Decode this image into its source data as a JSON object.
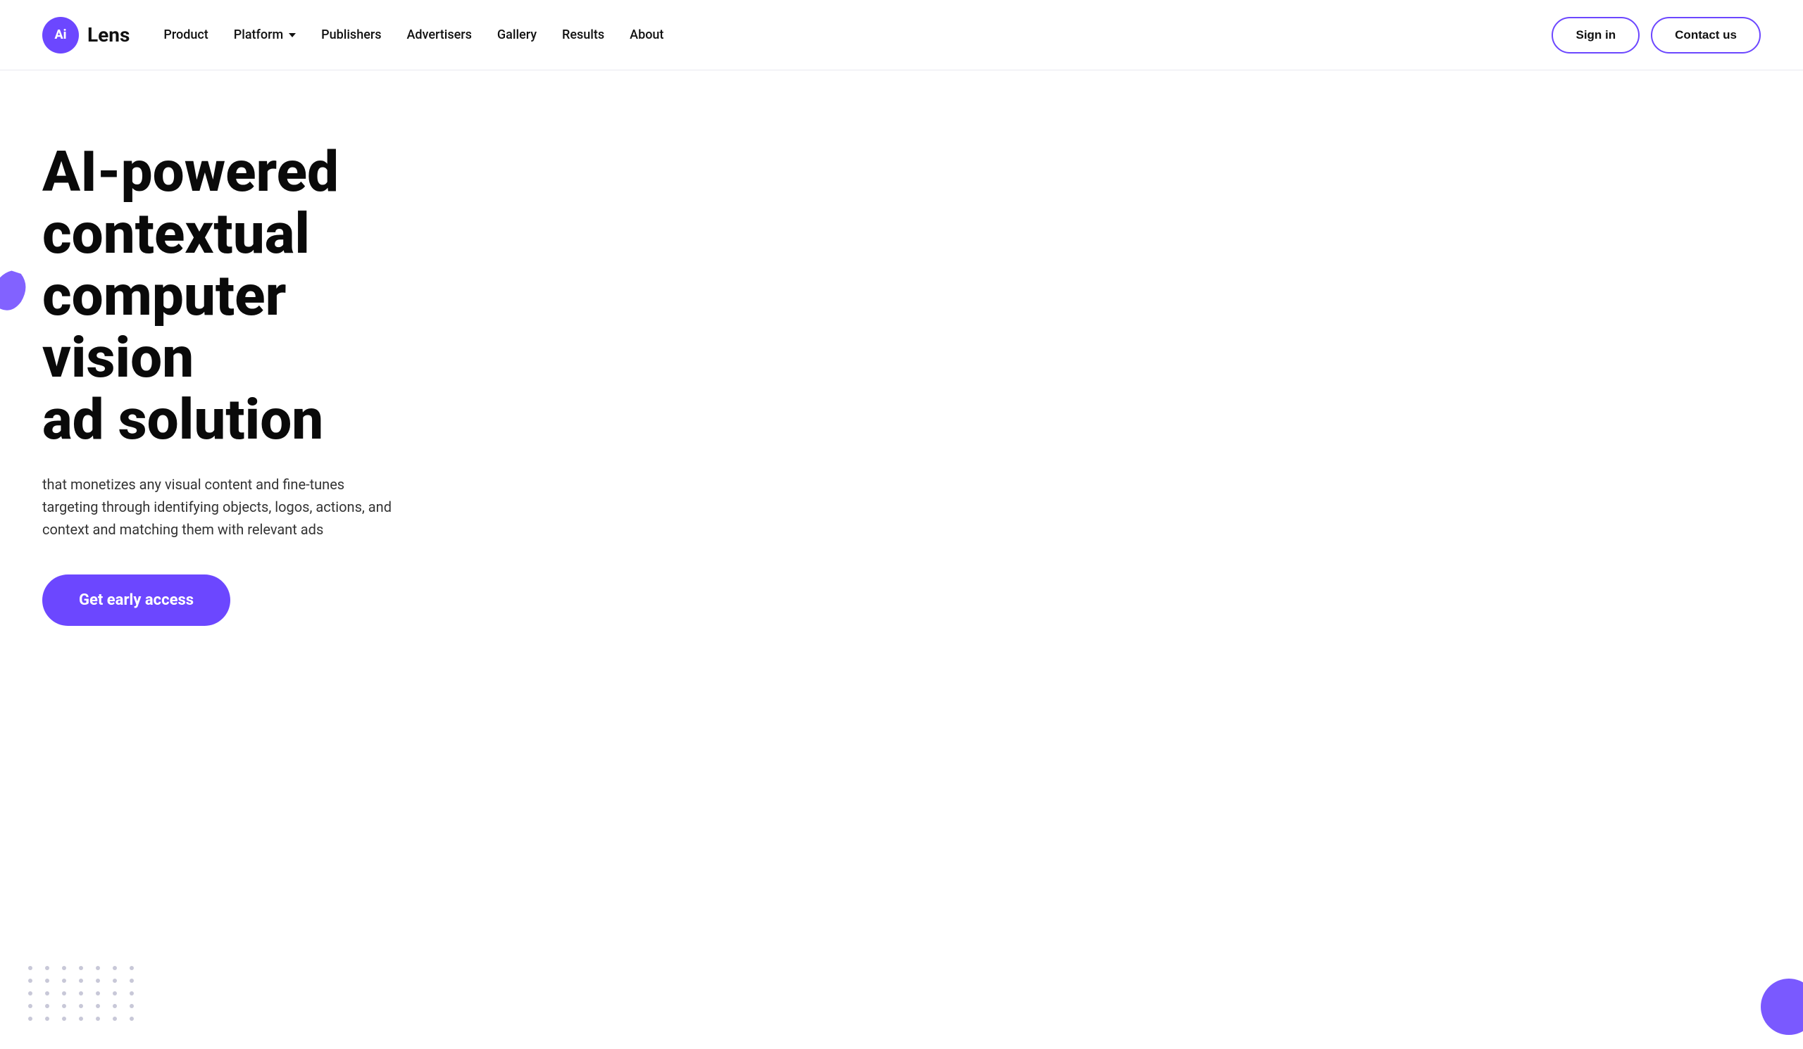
{
  "logo": {
    "icon_text": "Ai",
    "name": "Lens"
  },
  "nav": {
    "links": [
      {
        "id": "product",
        "label": "Product",
        "has_dropdown": false
      },
      {
        "id": "platform",
        "label": "Platform",
        "has_dropdown": true
      },
      {
        "id": "publishers",
        "label": "Publishers",
        "has_dropdown": false
      },
      {
        "id": "advertisers",
        "label": "Advertisers",
        "has_dropdown": false
      },
      {
        "id": "gallery",
        "label": "Gallery",
        "has_dropdown": false
      },
      {
        "id": "results",
        "label": "Results",
        "has_dropdown": false
      },
      {
        "id": "about",
        "label": "About",
        "has_dropdown": false
      }
    ],
    "sign_in_label": "Sign in",
    "contact_label": "Contact us"
  },
  "hero": {
    "title_line1": "AI-powered",
    "title_line2": "contextual",
    "title_line3": "computer vision",
    "title_line4": "ad solution",
    "subtitle": "that monetizes any visual content and fine-tunes targeting through identifying objects, logos, actions, and context and matching them with relevant ads",
    "cta_label": "Get early access"
  },
  "colors": {
    "brand_purple": "#6c47ff",
    "text_dark": "#0a0a0a",
    "text_medium": "#333333",
    "dots_color": "#c8c8d8"
  }
}
